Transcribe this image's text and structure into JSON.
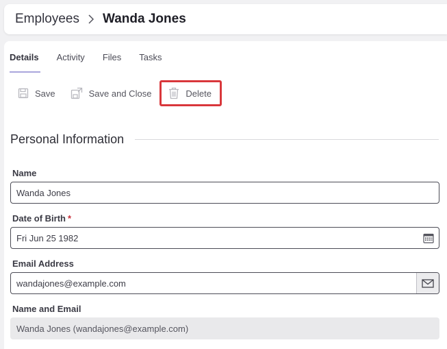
{
  "breadcrumb": {
    "root": "Employees",
    "current": "Wanda Jones"
  },
  "tabs": [
    {
      "label": "Details",
      "active": true
    },
    {
      "label": "Activity"
    },
    {
      "label": "Files"
    },
    {
      "label": "Tasks"
    }
  ],
  "toolbar": {
    "save": "Save",
    "save_close": "Save and Close",
    "delete": "Delete"
  },
  "section": {
    "title": "Personal Information"
  },
  "fields": {
    "name": {
      "label": "Name",
      "value": "Wanda Jones"
    },
    "dob": {
      "label": "Date of Birth",
      "required_mark": "*",
      "value": "Fri Jun 25 1982"
    },
    "email": {
      "label": "Email Address",
      "value": "wandajones@example.com"
    },
    "name_email": {
      "label": "Name and Email",
      "value": "Wanda Jones (wandajones@example.com)"
    }
  },
  "colors": {
    "highlight": "#d9373b",
    "tab_indicator": "#a9a5dc",
    "required": "#c8303a"
  },
  "icons": [
    "chevron-right-icon",
    "save-icon",
    "save-close-icon",
    "trash-icon",
    "calendar-icon",
    "envelope-icon"
  ]
}
